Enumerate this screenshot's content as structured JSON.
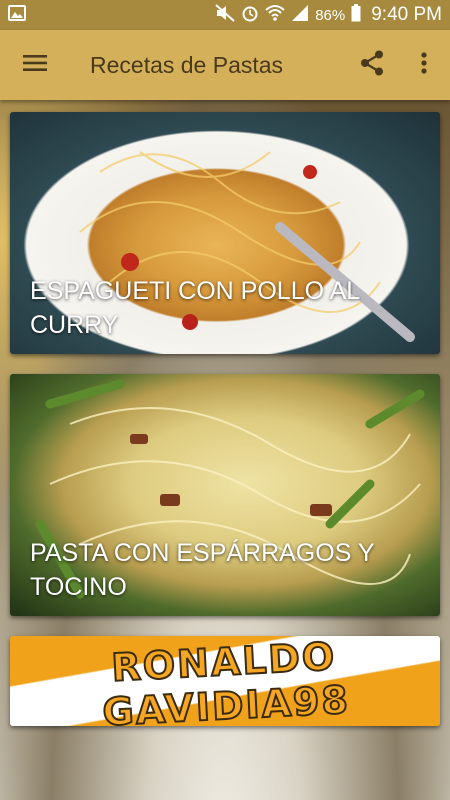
{
  "status_bar": {
    "battery": "86%",
    "time": "9:40 PM"
  },
  "app_bar": {
    "title": "Recetas de Pastas",
    "icons": [
      "menu-icon",
      "share-icon",
      "more-vert-icon"
    ]
  },
  "recipes": [
    {
      "title": "ESPAGUETI CON POLLO AL CURRY"
    },
    {
      "title": "PASTA CON ESPÁRRAGOS Y TOCINO"
    }
  ],
  "banner": {
    "text": "RONALDO GAVIDIA98"
  },
  "colors": {
    "status_bar": "#a88a3e",
    "app_bar": "#d4b05a",
    "title_text": "#4a3a1c"
  }
}
